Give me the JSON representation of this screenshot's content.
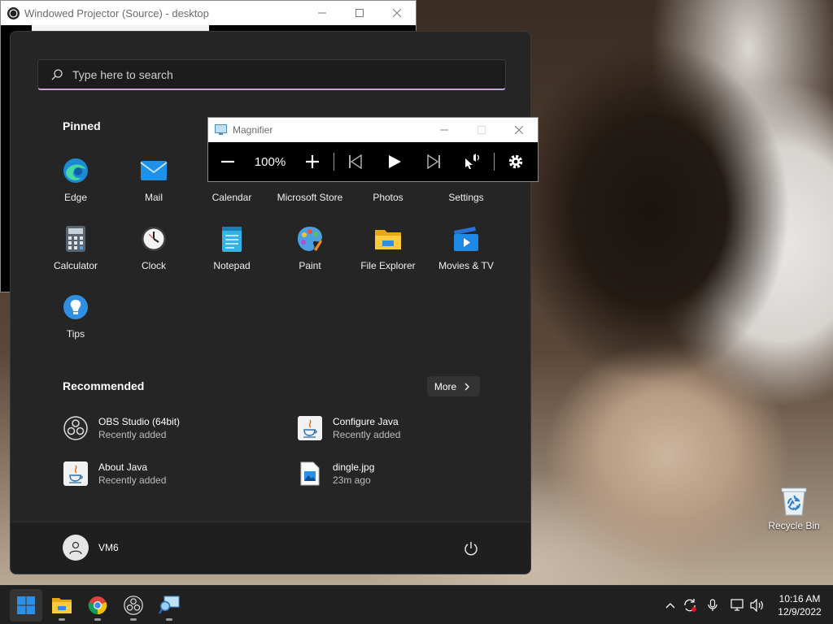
{
  "projector": {
    "title": "Windowed Projector (Source) - desktop"
  },
  "start_menu": {
    "search_placeholder": "Type here to search",
    "pinned_title": "Pinned",
    "pinned": [
      {
        "label": "Edge",
        "icon": "edge-icon"
      },
      {
        "label": "Mail",
        "icon": "mail-icon"
      },
      {
        "label": "Calendar",
        "icon": "calendar-icon"
      },
      {
        "label": "Microsoft Store",
        "icon": "store-icon"
      },
      {
        "label": "Photos",
        "icon": "photos-icon"
      },
      {
        "label": "Settings",
        "icon": "settings-icon"
      },
      {
        "label": "Calculator",
        "icon": "calculator-icon"
      },
      {
        "label": "Clock",
        "icon": "clock-icon"
      },
      {
        "label": "Notepad",
        "icon": "notepad-icon"
      },
      {
        "label": "Paint",
        "icon": "paint-icon"
      },
      {
        "label": "File Explorer",
        "icon": "folder-icon"
      },
      {
        "label": "Movies & TV",
        "icon": "movies-icon"
      },
      {
        "label": "Tips",
        "icon": "tips-icon"
      }
    ],
    "recommended_title": "Recommended",
    "more_label": "More",
    "recommended": [
      {
        "name": "OBS Studio (64bit)",
        "sub": "Recently added",
        "icon": "obs-icon"
      },
      {
        "name": "Configure Java",
        "sub": "Recently added",
        "icon": "java-icon"
      },
      {
        "name": "About Java",
        "sub": "Recently added",
        "icon": "java-icon"
      },
      {
        "name": "dingle.jpg",
        "sub": "23m ago",
        "icon": "image-file-icon"
      }
    ],
    "user_name": "VM6"
  },
  "magnifier": {
    "title": "Magnifier",
    "zoom": "100%"
  },
  "desktop": {
    "recycle_bin_label": "Recycle Bin"
  },
  "taskbar": {
    "time": "10:16 AM",
    "date": "12/9/2022"
  },
  "colors": {
    "start_bg": "#252525",
    "search_accent": "#c7a6d6",
    "taskbar_bg": "#202020",
    "windows_blue": "#2b8fe8"
  }
}
